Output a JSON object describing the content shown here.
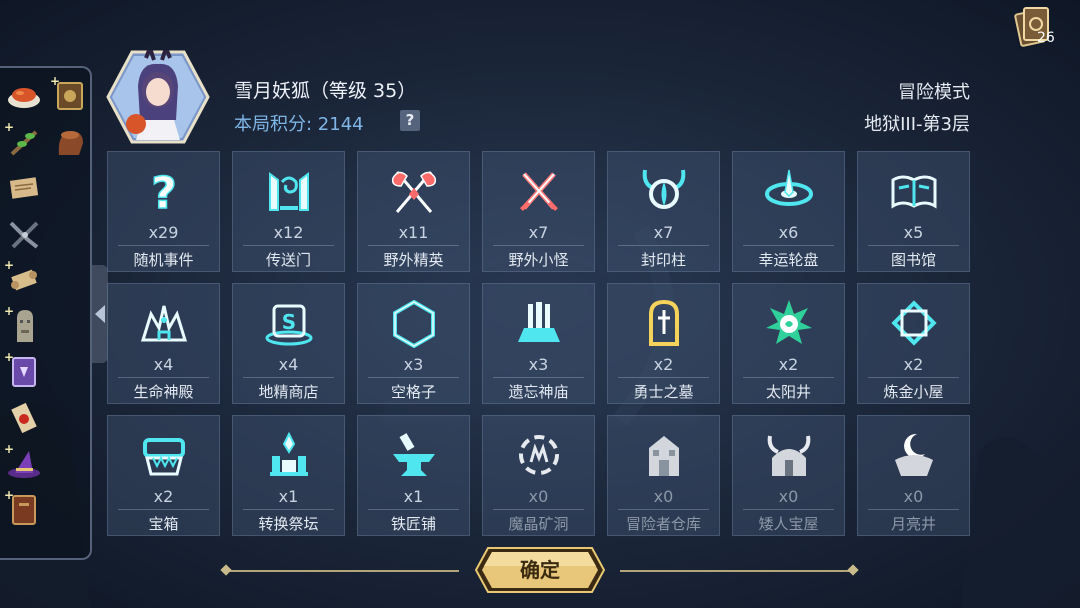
{
  "header": {
    "hero_name": "雪月妖狐（等级 35）",
    "score_label": "本局积分: 2144",
    "help_glyph": "?",
    "mode": "冒险模式",
    "floor": "地狱III-第3层"
  },
  "deck": {
    "count": "26",
    "icon": "card-deck-icon"
  },
  "inventory": [
    {
      "icon": "roast-meat-icon"
    },
    {
      "icon": "spellbook-icon",
      "plus": "+"
    },
    {
      "icon": "herb-branch-icon",
      "plus": "+"
    },
    {
      "icon": "tree-stump-icon"
    },
    {
      "icon": "parchment-icon"
    },
    {
      "icon": "pliers-icon"
    },
    {
      "icon": "scroll-icon",
      "plus": "+"
    },
    {
      "icon": "moai-statue-icon",
      "plus": "+"
    },
    {
      "icon": "magic-tome-icon",
      "plus": "+"
    },
    {
      "icon": "sealed-scroll-icon"
    },
    {
      "icon": "wizard-hat-icon",
      "plus": "+"
    },
    {
      "icon": "leather-book-icon",
      "plus": "+"
    }
  ],
  "buildings": [
    {
      "label": "随机事件",
      "count": "x29",
      "icon": "question-mark-icon"
    },
    {
      "label": "传送门",
      "count": "x12",
      "icon": "portal-icon"
    },
    {
      "label": "野外精英",
      "count": "x11",
      "icon": "crossed-axes-icon"
    },
    {
      "label": "野外小怪",
      "count": "x7",
      "icon": "crossed-swords-icon"
    },
    {
      "label": "封印柱",
      "count": "x7",
      "icon": "seal-pillar-icon"
    },
    {
      "label": "幸运轮盘",
      "count": "x6",
      "icon": "lucky-wheel-icon"
    },
    {
      "label": "图书馆",
      "count": "x5",
      "icon": "open-book-icon"
    },
    {
      "label": "生命神殿",
      "count": "x4",
      "icon": "life-temple-icon"
    },
    {
      "label": "地精商店",
      "count": "x4",
      "icon": "goblin-shop-icon"
    },
    {
      "label": "空格子",
      "count": "x3",
      "icon": "empty-hexagon-icon"
    },
    {
      "label": "遗忘神庙",
      "count": "x3",
      "icon": "forgotten-temple-icon"
    },
    {
      "label": "勇士之墓",
      "count": "x2",
      "icon": "tombstone-icon"
    },
    {
      "label": "太阳井",
      "count": "x2",
      "icon": "sun-well-icon"
    },
    {
      "label": "炼金小屋",
      "count": "x2",
      "icon": "alchemy-hut-icon"
    },
    {
      "label": "宝箱",
      "count": "x2",
      "icon": "treasure-chest-icon"
    },
    {
      "label": "转换祭坛",
      "count": "x1",
      "icon": "conversion-altar-icon"
    },
    {
      "label": "铁匠铺",
      "count": "x1",
      "icon": "anvil-icon"
    },
    {
      "label": "魔晶矿洞",
      "count": "x0",
      "icon": "crystal-mine-icon"
    },
    {
      "label": "冒险者仓库",
      "count": "x0",
      "icon": "warehouse-icon"
    },
    {
      "label": "矮人宝屋",
      "count": "x0",
      "icon": "dwarf-vault-icon"
    },
    {
      "label": "月亮井",
      "count": "x0",
      "icon": "moon-well-icon"
    }
  ],
  "confirm_label": "确定",
  "colors": {
    "accent": "#4fe6f0",
    "gold": "#e8c873",
    "red": "#ff6a6a",
    "zero": "#9aa3b0"
  }
}
